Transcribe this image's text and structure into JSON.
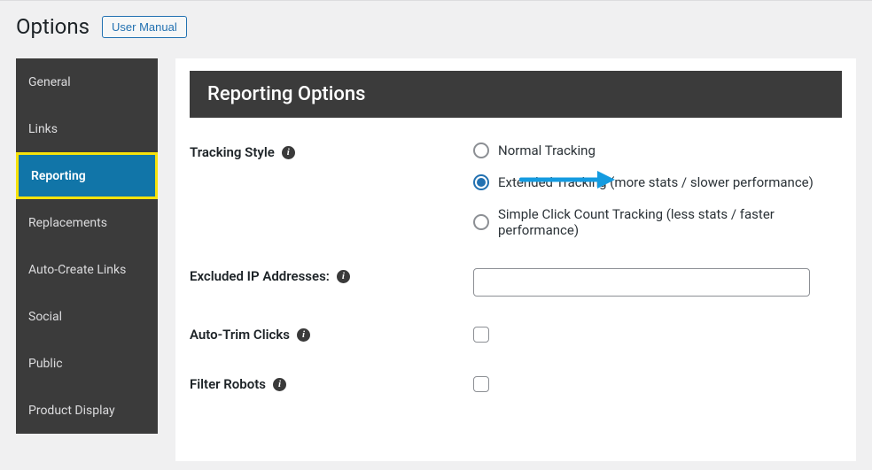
{
  "header": {
    "title": "Options",
    "manual_button": "User Manual"
  },
  "sidebar": {
    "items": [
      {
        "label": "General",
        "active": false
      },
      {
        "label": "Links",
        "active": false
      },
      {
        "label": "Reporting",
        "active": true
      },
      {
        "label": "Replacements",
        "active": false
      },
      {
        "label": "Auto-Create Links",
        "active": false
      },
      {
        "label": "Social",
        "active": false
      },
      {
        "label": "Public",
        "active": false
      },
      {
        "label": "Product Display",
        "active": false
      }
    ]
  },
  "panel": {
    "title": "Reporting Options"
  },
  "form": {
    "tracking_style": {
      "label": "Tracking Style",
      "options": [
        {
          "label": "Normal Tracking",
          "checked": false
        },
        {
          "label": "Extended Tracking (more stats / slower performance)",
          "checked": true
        },
        {
          "label": "Simple Click Count Tracking (less stats / faster performance)",
          "checked": false
        }
      ]
    },
    "excluded_ips": {
      "label": "Excluded IP Addresses:",
      "value": ""
    },
    "auto_trim": {
      "label": "Auto-Trim Clicks",
      "checked": false
    },
    "filter_robots": {
      "label": "Filter Robots",
      "checked": false
    }
  },
  "colors": {
    "accent": "#2271b1",
    "sidebar_bg": "#3b3b3b",
    "highlight_border": "#f6e20c",
    "arrow": "#149be0"
  }
}
